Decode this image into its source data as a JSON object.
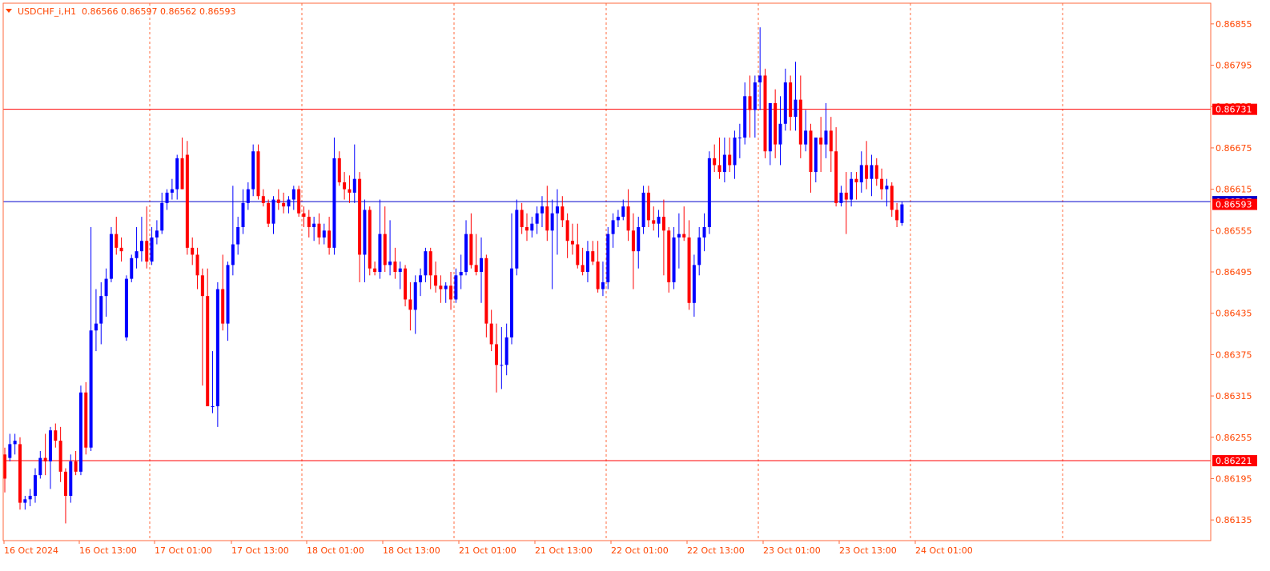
{
  "header": {
    "symbol": "USDCHF_i,H1",
    "ohlc": "0.86566 0.86597 0.86562 0.86593"
  },
  "colors": {
    "frame": "#FF6A3D",
    "text": "#FF4500",
    "bull": "#0000FF",
    "bear": "#FF0000",
    "hline": "#FF0000",
    "bid_line": "#0000CD",
    "label_bg": "#FF0000",
    "label_text": "#FFFFFF",
    "background": "#FFFFFF"
  },
  "price_axis": {
    "ticks": [
      "0.86855",
      "0.86795",
      "0.86735",
      "0.86675",
      "0.86615",
      "0.86555",
      "0.86495",
      "0.86435",
      "0.86375",
      "0.86315",
      "0.86255",
      "0.86195",
      "0.86135"
    ],
    "horizontal_lines": [
      {
        "price": 0.86731,
        "label": "0.86731"
      },
      {
        "price": 0.86221,
        "label": "0.86221"
      }
    ],
    "bid_line": {
      "price": 0.86597,
      "label": "0.86597"
    },
    "current_price": {
      "price": 0.86593,
      "label": "0.86593"
    }
  },
  "time_axis": {
    "labels": [
      "16 Oct 2024",
      "16 Oct 13:00",
      "17 Oct 01:00",
      "17 Oct 13:00",
      "18 Oct 01:00",
      "18 Oct 13:00",
      "21 Oct 01:00",
      "21 Oct 13:00",
      "22 Oct 01:00",
      "22 Oct 13:00",
      "23 Oct 01:00",
      "23 Oct 13:00",
      "24 Oct 01:00"
    ],
    "session_separators": [
      "17 Oct 01:00",
      "18 Oct 01:00",
      "21 Oct 01:00",
      "22 Oct 01:00",
      "23 Oct 01:00",
      "24 Oct 01:00",
      "25 Oct 01:00"
    ]
  },
  "chart_data": {
    "type": "candlestick",
    "symbol": "USDCHF_i",
    "timeframe": "H1",
    "price_range": [
      0.86105,
      0.86885
    ],
    "candles": [
      [
        0.8623,
        0.8624,
        0.86175,
        0.86195
      ],
      [
        0.86225,
        0.8626,
        0.8622,
        0.86245
      ],
      [
        0.86245,
        0.8626,
        0.8623,
        0.8625
      ],
      [
        0.86245,
        0.86255,
        0.8615,
        0.8616
      ],
      [
        0.8616,
        0.8617,
        0.8615,
        0.86165
      ],
      [
        0.86165,
        0.8618,
        0.86155,
        0.8617
      ],
      [
        0.8617,
        0.8621,
        0.8616,
        0.862
      ],
      [
        0.862,
        0.86235,
        0.86195,
        0.86225
      ],
      [
        0.86225,
        0.8626,
        0.862,
        0.8622
      ],
      [
        0.8622,
        0.8627,
        0.8618,
        0.86265
      ],
      [
        0.86265,
        0.86275,
        0.8624,
        0.8625
      ],
      [
        0.8625,
        0.8627,
        0.8619,
        0.86205
      ],
      [
        0.86205,
        0.8621,
        0.8613,
        0.8617
      ],
      [
        0.8617,
        0.8623,
        0.8616,
        0.8622
      ],
      [
        0.8622,
        0.86235,
        0.862,
        0.86205
      ],
      [
        0.86205,
        0.8633,
        0.862,
        0.8632
      ],
      [
        0.8632,
        0.86335,
        0.8623,
        0.8624
      ],
      [
        0.8624,
        0.8656,
        0.86235,
        0.8641
      ],
      [
        0.8641,
        0.8647,
        0.8638,
        0.8642
      ],
      [
        0.8642,
        0.8648,
        0.8639,
        0.8646
      ],
      [
        0.8646,
        0.865,
        0.8643,
        0.86485
      ],
      [
        0.86485,
        0.8656,
        0.8648,
        0.8655
      ],
      [
        0.8655,
        0.86575,
        0.8652,
        0.8653
      ],
      [
        0.8653,
        0.86545,
        0.8651,
        0.86525
      ],
      [
        0.864,
        0.8649,
        0.86395,
        0.86485
      ],
      [
        0.86485,
        0.8652,
        0.8648,
        0.86515
      ],
      [
        0.86515,
        0.8656,
        0.865,
        0.86525
      ],
      [
        0.86525,
        0.86575,
        0.8651,
        0.8654
      ],
      [
        0.8654,
        0.8659,
        0.865,
        0.8651
      ],
      [
        0.8651,
        0.8656,
        0.86505,
        0.86545
      ],
      [
        0.86545,
        0.8657,
        0.86535,
        0.86555
      ],
      [
        0.86555,
        0.8661,
        0.8655,
        0.86595
      ],
      [
        0.86595,
        0.86615,
        0.86585,
        0.8661
      ],
      [
        0.8661,
        0.8663,
        0.866,
        0.86615
      ],
      [
        0.86615,
        0.86665,
        0.866,
        0.8666
      ],
      [
        0.8666,
        0.8669,
        0.86615,
        0.86615
      ],
      [
        0.86665,
        0.86685,
        0.8652,
        0.8653
      ],
      [
        0.8653,
        0.86545,
        0.86505,
        0.8652
      ],
      [
        0.8652,
        0.8653,
        0.8647,
        0.8649
      ],
      [
        0.8649,
        0.865,
        0.8633,
        0.8646
      ],
      [
        0.8646,
        0.865,
        0.863,
        0.863
      ],
      [
        0.863,
        0.8638,
        0.8629,
        0.863
      ],
      [
        0.863,
        0.8648,
        0.8627,
        0.8647
      ],
      [
        0.8647,
        0.8652,
        0.8641,
        0.8642
      ],
      [
        0.8642,
        0.8651,
        0.86395,
        0.86505
      ],
      [
        0.86505,
        0.8662,
        0.8649,
        0.86535
      ],
      [
        0.86535,
        0.86575,
        0.8652,
        0.8656
      ],
      [
        0.8656,
        0.86615,
        0.8655,
        0.86595
      ],
      [
        0.86595,
        0.86625,
        0.86585,
        0.86615
      ],
      [
        0.86615,
        0.8668,
        0.86605,
        0.8667
      ],
      [
        0.8667,
        0.8668,
        0.866,
        0.86605
      ],
      [
        0.86605,
        0.86615,
        0.8659,
        0.86595
      ],
      [
        0.86595,
        0.866,
        0.8656,
        0.86565
      ],
      [
        0.86565,
        0.86605,
        0.8655,
        0.866
      ],
      [
        0.866,
        0.86615,
        0.86585,
        0.86595
      ],
      [
        0.86595,
        0.8661,
        0.8658,
        0.8659
      ],
      [
        0.8659,
        0.86605,
        0.8658,
        0.866
      ],
      [
        0.866,
        0.8662,
        0.86585,
        0.86615
      ],
      [
        0.86615,
        0.8662,
        0.86575,
        0.8658
      ],
      [
        0.8658,
        0.8659,
        0.8656,
        0.86575
      ],
      [
        0.86575,
        0.86585,
        0.86545,
        0.8656
      ],
      [
        0.8656,
        0.86575,
        0.8654,
        0.86565
      ],
      [
        0.86565,
        0.8658,
        0.86535,
        0.86545
      ],
      [
        0.86545,
        0.86565,
        0.86535,
        0.86555
      ],
      [
        0.86555,
        0.86575,
        0.8652,
        0.8653
      ],
      [
        0.8653,
        0.8669,
        0.8652,
        0.8666
      ],
      [
        0.8666,
        0.8667,
        0.8662,
        0.86625
      ],
      [
        0.86625,
        0.8664,
        0.866,
        0.86615
      ],
      [
        0.86615,
        0.86635,
        0.86595,
        0.8661
      ],
      [
        0.8661,
        0.8668,
        0.86595,
        0.8663
      ],
      [
        0.8663,
        0.8664,
        0.8648,
        0.8652
      ],
      [
        0.8652,
        0.866,
        0.8648,
        0.86585
      ],
      [
        0.86585,
        0.8659,
        0.8649,
        0.865
      ],
      [
        0.865,
        0.8651,
        0.8649,
        0.86495
      ],
      [
        0.86495,
        0.866,
        0.86485,
        0.8655
      ],
      [
        0.8655,
        0.8659,
        0.86495,
        0.86505
      ],
      [
        0.86505,
        0.8657,
        0.8649,
        0.8651
      ],
      [
        0.8651,
        0.8653,
        0.86485,
        0.86495
      ],
      [
        0.86495,
        0.8651,
        0.8647,
        0.865
      ],
      [
        0.865,
        0.86505,
        0.86445,
        0.86455
      ],
      [
        0.86455,
        0.8648,
        0.8641,
        0.8644
      ],
      [
        0.8644,
        0.8649,
        0.86405,
        0.8648
      ],
      [
        0.8648,
        0.865,
        0.8646,
        0.8649
      ],
      [
        0.8649,
        0.8653,
        0.8648,
        0.86525
      ],
      [
        0.86525,
        0.8653,
        0.8647,
        0.8649
      ],
      [
        0.8649,
        0.8651,
        0.86465,
        0.86475
      ],
      [
        0.86475,
        0.8649,
        0.8645,
        0.8647
      ],
      [
        0.8647,
        0.8648,
        0.8645,
        0.86475
      ],
      [
        0.86475,
        0.86495,
        0.8644,
        0.86455
      ],
      [
        0.86455,
        0.865,
        0.8645,
        0.8649
      ],
      [
        0.8649,
        0.8652,
        0.8647,
        0.86495
      ],
      [
        0.86495,
        0.8657,
        0.8649,
        0.8655
      ],
      [
        0.8655,
        0.8658,
        0.865,
        0.86505
      ],
      [
        0.86505,
        0.8655,
        0.8649,
        0.86495
      ],
      [
        0.86495,
        0.86545,
        0.8645,
        0.86515
      ],
      [
        0.86515,
        0.8652,
        0.864,
        0.8642
      ],
      [
        0.8642,
        0.8644,
        0.8638,
        0.8639
      ],
      [
        0.8639,
        0.8642,
        0.8632,
        0.8636
      ],
      [
        0.8636,
        0.86415,
        0.86325,
        0.8636
      ],
      [
        0.8636,
        0.8642,
        0.86345,
        0.864
      ],
      [
        0.864,
        0.8658,
        0.8639,
        0.865
      ],
      [
        0.865,
        0.866,
        0.8649,
        0.86585
      ],
      [
        0.86585,
        0.86595,
        0.8655,
        0.8656
      ],
      [
        0.8656,
        0.8658,
        0.8654,
        0.86555
      ],
      [
        0.86555,
        0.86575,
        0.86545,
        0.86565
      ],
      [
        0.86565,
        0.8659,
        0.8655,
        0.8658
      ],
      [
        0.8658,
        0.86605,
        0.8656,
        0.8659
      ],
      [
        0.8659,
        0.8662,
        0.8654,
        0.86555
      ],
      [
        0.86555,
        0.866,
        0.8647,
        0.8658
      ],
      [
        0.8658,
        0.86615,
        0.8652,
        0.8659
      ],
      [
        0.8659,
        0.86605,
        0.8656,
        0.8657
      ],
      [
        0.8657,
        0.8658,
        0.86515,
        0.8654
      ],
      [
        0.8654,
        0.86565,
        0.8652,
        0.86535
      ],
      [
        0.86535,
        0.86565,
        0.865,
        0.86505
      ],
      [
        0.86505,
        0.8653,
        0.8649,
        0.86495
      ],
      [
        0.86495,
        0.8654,
        0.8648,
        0.86525
      ],
      [
        0.86525,
        0.8654,
        0.86505,
        0.8651
      ],
      [
        0.8651,
        0.8654,
        0.86465,
        0.8647
      ],
      [
        0.8647,
        0.8651,
        0.8646,
        0.8648
      ],
      [
        0.8648,
        0.8656,
        0.8647,
        0.8655
      ],
      [
        0.8655,
        0.8658,
        0.8653,
        0.8657
      ],
      [
        0.8657,
        0.86585,
        0.8656,
        0.86575
      ],
      [
        0.86575,
        0.866,
        0.8657,
        0.8659
      ],
      [
        0.8659,
        0.86615,
        0.8654,
        0.86555
      ],
      [
        0.86555,
        0.8658,
        0.8647,
        0.86525
      ],
      [
        0.86525,
        0.86575,
        0.865,
        0.8656
      ],
      [
        0.8656,
        0.8662,
        0.8655,
        0.8661
      ],
      [
        0.8661,
        0.8662,
        0.8656,
        0.8657
      ],
      [
        0.8657,
        0.8659,
        0.86555,
        0.86565
      ],
      [
        0.86565,
        0.86585,
        0.86545,
        0.86575
      ],
      [
        0.86575,
        0.866,
        0.8649,
        0.86555
      ],
      [
        0.86555,
        0.8656,
        0.86465,
        0.8648
      ],
      [
        0.8648,
        0.8656,
        0.8647,
        0.86545
      ],
      [
        0.86545,
        0.8658,
        0.865,
        0.8655
      ],
      [
        0.8655,
        0.8659,
        0.8654,
        0.86545
      ],
      [
        0.86545,
        0.8657,
        0.8644,
        0.8645
      ],
      [
        0.8645,
        0.8652,
        0.8643,
        0.86505
      ],
      [
        0.86505,
        0.8656,
        0.8649,
        0.86545
      ],
      [
        0.86545,
        0.8658,
        0.86525,
        0.8656
      ],
      [
        0.8656,
        0.8667,
        0.8655,
        0.8666
      ],
      [
        0.8666,
        0.8668,
        0.8664,
        0.8665
      ],
      [
        0.8665,
        0.8669,
        0.8663,
        0.8664
      ],
      [
        0.8664,
        0.8669,
        0.86625,
        0.86665
      ],
      [
        0.86665,
        0.8669,
        0.8664,
        0.8665
      ],
      [
        0.8665,
        0.867,
        0.8663,
        0.8669
      ],
      [
        0.8669,
        0.8671,
        0.8666,
        0.8669
      ],
      [
        0.8669,
        0.8677,
        0.8668,
        0.8675
      ],
      [
        0.8675,
        0.8678,
        0.8669,
        0.8673
      ],
      [
        0.8673,
        0.8678,
        0.8669,
        0.8677
      ],
      [
        0.8677,
        0.8685,
        0.8673,
        0.8678
      ],
      [
        0.8678,
        0.8679,
        0.8666,
        0.8667
      ],
      [
        0.8667,
        0.8674,
        0.8665,
        0.8674
      ],
      [
        0.8674,
        0.8676,
        0.8666,
        0.8668
      ],
      [
        0.8668,
        0.8675,
        0.8665,
        0.8671
      ],
      [
        0.8671,
        0.8679,
        0.867,
        0.8677
      ],
      [
        0.8677,
        0.8678,
        0.867,
        0.8672
      ],
      [
        0.8672,
        0.868,
        0.867,
        0.86745
      ],
      [
        0.86745,
        0.8678,
        0.8666,
        0.8668
      ],
      [
        0.8668,
        0.8673,
        0.8667,
        0.867
      ],
      [
        0.867,
        0.8671,
        0.8661,
        0.8664
      ],
      [
        0.8664,
        0.8669,
        0.86625,
        0.8669
      ],
      [
        0.8669,
        0.8672,
        0.8664,
        0.8668
      ],
      [
        0.8668,
        0.8674,
        0.8666,
        0.867
      ],
      [
        0.867,
        0.8672,
        0.8664,
        0.8667
      ],
      [
        0.8667,
        0.86705,
        0.8659,
        0.86595
      ],
      [
        0.86595,
        0.8662,
        0.8659,
        0.8661
      ],
      [
        0.8661,
        0.8664,
        0.8655,
        0.866
      ],
      [
        0.866,
        0.8664,
        0.8659,
        0.8663
      ],
      [
        0.8663,
        0.8664,
        0.866,
        0.86625
      ],
      [
        0.86625,
        0.8667,
        0.8661,
        0.8665
      ],
      [
        0.8665,
        0.86685,
        0.86615,
        0.8663
      ],
      [
        0.8663,
        0.86665,
        0.86605,
        0.8665
      ],
      [
        0.8665,
        0.8666,
        0.8662,
        0.8663
      ],
      [
        0.8663,
        0.86645,
        0.866,
        0.86615
      ],
      [
        0.86615,
        0.8663,
        0.8659,
        0.8662
      ],
      [
        0.8662,
        0.86625,
        0.86575,
        0.86585
      ],
      [
        0.86585,
        0.86595,
        0.8656,
        0.8657
      ],
      [
        0.86566,
        0.86597,
        0.86562,
        0.86593
      ]
    ]
  }
}
